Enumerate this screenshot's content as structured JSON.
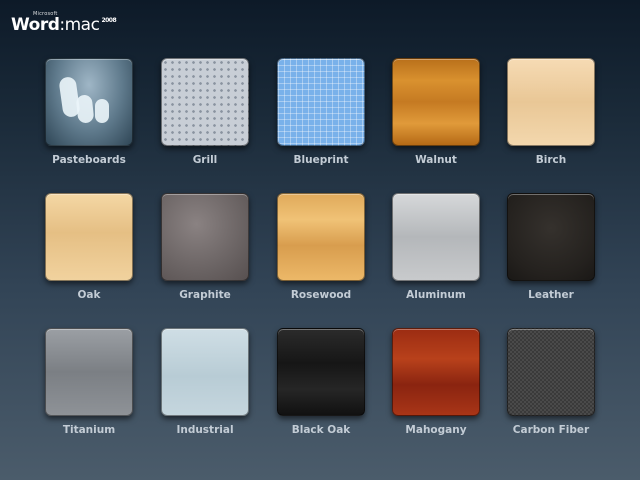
{
  "app": {
    "vendor": "Microsoft",
    "product": "Word",
    "platform": ":mac",
    "year": "2008"
  },
  "templates": [
    {
      "label": "Pasteboards",
      "id": "pasteboards"
    },
    {
      "label": "Grill",
      "id": "grill"
    },
    {
      "label": "Blueprint",
      "id": "blueprint"
    },
    {
      "label": "Walnut",
      "id": "walnut"
    },
    {
      "label": "Birch",
      "id": "birch"
    },
    {
      "label": "Oak",
      "id": "oak"
    },
    {
      "label": "Graphite",
      "id": "graphite"
    },
    {
      "label": "Rosewood",
      "id": "rosewood"
    },
    {
      "label": "Aluminum",
      "id": "aluminum"
    },
    {
      "label": "Leather",
      "id": "leather"
    },
    {
      "label": "Titanium",
      "id": "titanium"
    },
    {
      "label": "Industrial",
      "id": "industrial"
    },
    {
      "label": "Black Oak",
      "id": "blackoak"
    },
    {
      "label": "Mahogany",
      "id": "mahogany"
    },
    {
      "label": "Carbon Fiber",
      "id": "carbon"
    }
  ]
}
